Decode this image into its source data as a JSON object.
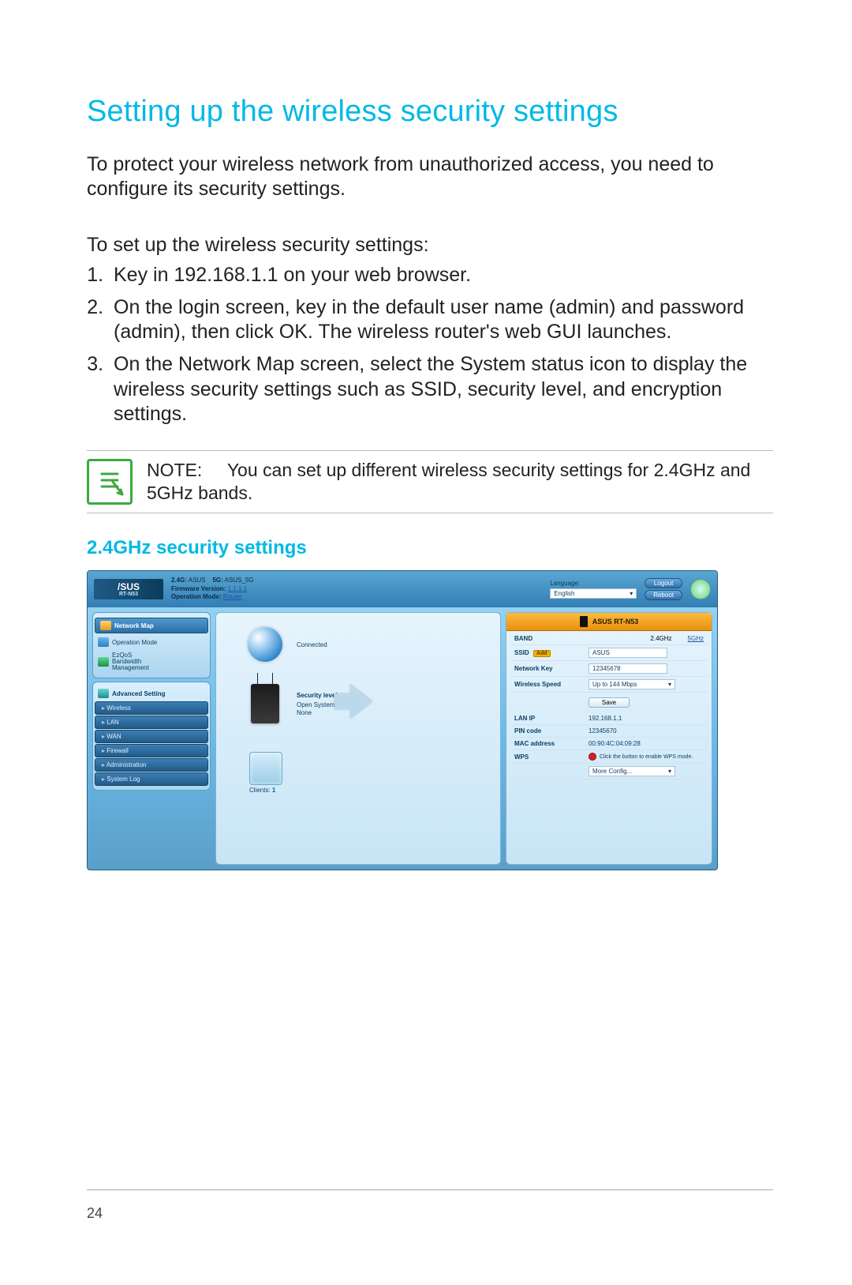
{
  "doc": {
    "title": "Setting up the wireless security settings",
    "intro": "To protect your wireless network from unauthorized access, you need to configure its security settings.",
    "subhead": "To set up the wireless security settings:",
    "steps": [
      "Key in 192.168.1.1 on your web browser.",
      "On the login screen, key in the default user name (admin) and password (admin), then click OK. The wireless router's web GUI launches.",
      "On the Network Map screen, select the System status icon to display the wireless security settings such as SSID, security level, and encryption settings."
    ],
    "note_label": "NOTE:",
    "note_text": "You can set up different wireless security settings for 2.4GHz and 5GHz bands.",
    "subsection": "2.4GHz security settings",
    "page_number": "24"
  },
  "gui": {
    "logo_top": "/SUS",
    "logo_bottom": "RT-N53",
    "top": {
      "g24_label": "2.4G:",
      "g24_value": "ASUS",
      "g5_label": "5G:",
      "g5_value": "ASUS_5G",
      "fw_label": "Firmware Version:",
      "fw_value": "1.1.1.1",
      "op_label": "Operation Mode:",
      "op_value": "Router",
      "lang_label": "Language:",
      "lang_value": "English",
      "logout": "Logout",
      "reboot": "Reboot"
    },
    "side": {
      "map": "Network Map",
      "opmode": "Operation Mode",
      "qos1": "EzQoS",
      "qos2": "Bandwidth",
      "qos3": "Management",
      "adv": "Advanced Setting",
      "subs": [
        "Wireless",
        "LAN",
        "WAN",
        "Firewall",
        "Administration",
        "System Log"
      ]
    },
    "center": {
      "connected": "Connected",
      "seclvl_label": "Security level:",
      "seclvl_value": "Open System",
      "seclvl_none": "None",
      "clients_label": "Clients:",
      "clients_value": "1"
    },
    "status": {
      "title": "ASUS RT-N53",
      "band_label": "BAND",
      "band_24": "2.4GHz",
      "band_5": "5GHz",
      "ssid_label": "SSID",
      "ssid_value": "ASUS",
      "ssid_add": "Add",
      "key_label": "Network Key",
      "key_value": "12345678",
      "speed_label": "Wireless Speed",
      "speed_value": "Up to 144 Mbps",
      "save": "Save",
      "lan_label": "LAN IP",
      "lan_value": "192.168.1.1",
      "pin_label": "PIN code",
      "pin_value": "12345670",
      "mac_label": "MAC address",
      "mac_value": "00:90:4C:04:09:28",
      "wps_label": "WPS",
      "wps_text": "Click the button to enable WPS mode.",
      "more_label": "More Config..."
    }
  }
}
